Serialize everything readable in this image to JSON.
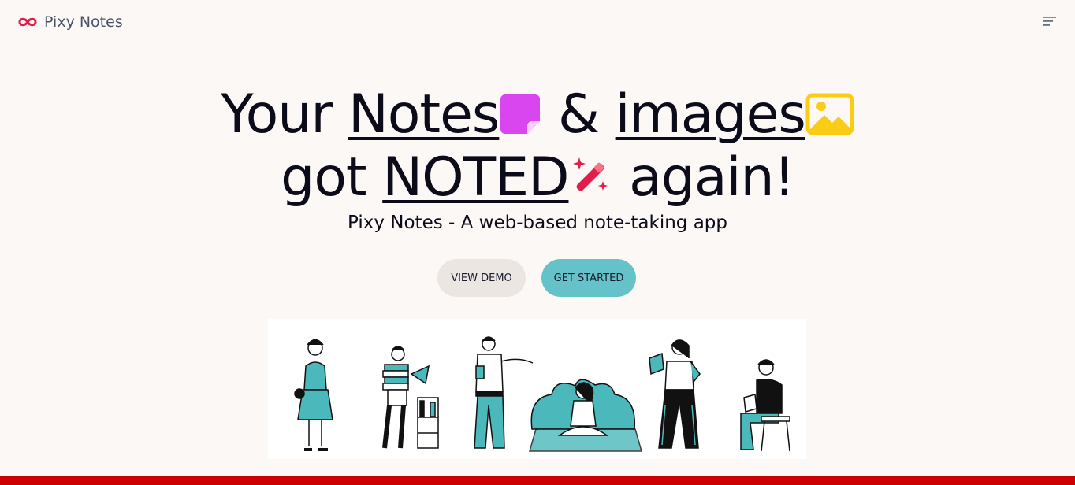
{
  "app": {
    "brand_name": "Pixy Notes"
  },
  "hero": {
    "line1_a": "Your ",
    "line1_b": "Notes",
    "line1_c": " & ",
    "line1_d": "images",
    "line2_a": "got ",
    "line2_b": "NOTED",
    "line2_c": " again!",
    "subtitle": "Pixy Notes - A web-based note-taking app"
  },
  "buttons": {
    "view_demo": "VIEW DEMO",
    "get_started": "GET STARTED"
  },
  "icons": {
    "logo": "infinity-icon",
    "menu": "menu-icon",
    "note": "sticky-note-icon",
    "image": "image-icon",
    "magic": "magic-wand-icon"
  },
  "colors": {
    "background": "#fcf8f6",
    "accent_teal": "#64c2c8",
    "note_purple": "#d946ef",
    "image_yellow": "#facc15",
    "logo_red": "#e11d48",
    "footer_red": "#cc0000"
  }
}
